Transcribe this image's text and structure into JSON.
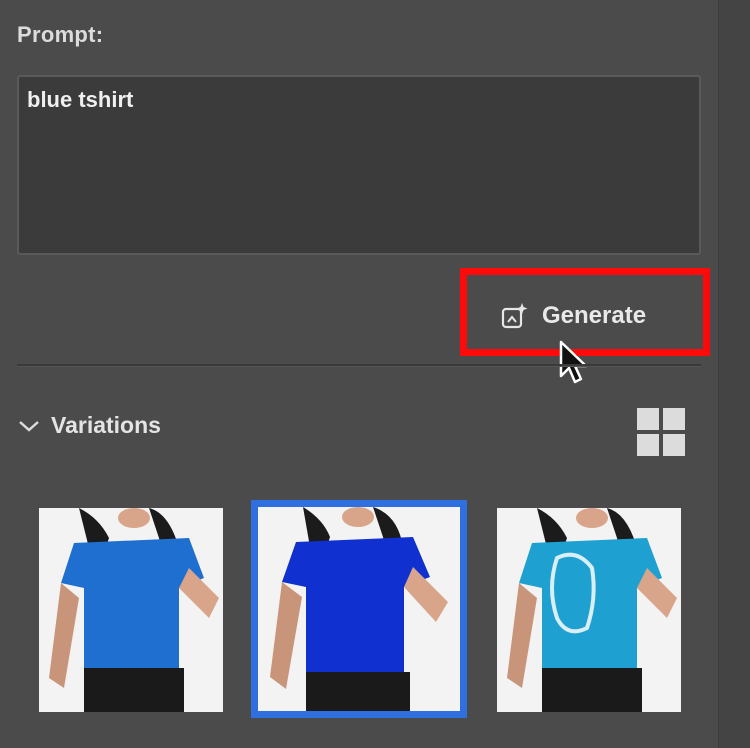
{
  "prompt": {
    "label": "Prompt:",
    "value": "blue tshirt"
  },
  "generate": {
    "label": "Generate",
    "icon": "generate-image-icon"
  },
  "variations": {
    "title": "Variations",
    "items": [
      {
        "name": "variation-1",
        "shirt_color": "#1e6fd0",
        "selected": false
      },
      {
        "name": "variation-2",
        "shirt_color": "#1030d0",
        "selected": true
      },
      {
        "name": "variation-3",
        "shirt_color": "#1ea0d0",
        "selected": false
      }
    ]
  },
  "colors": {
    "highlight": "#ff0a0a",
    "selection": "#2f6fe0",
    "panel": "#4b4b4b"
  }
}
